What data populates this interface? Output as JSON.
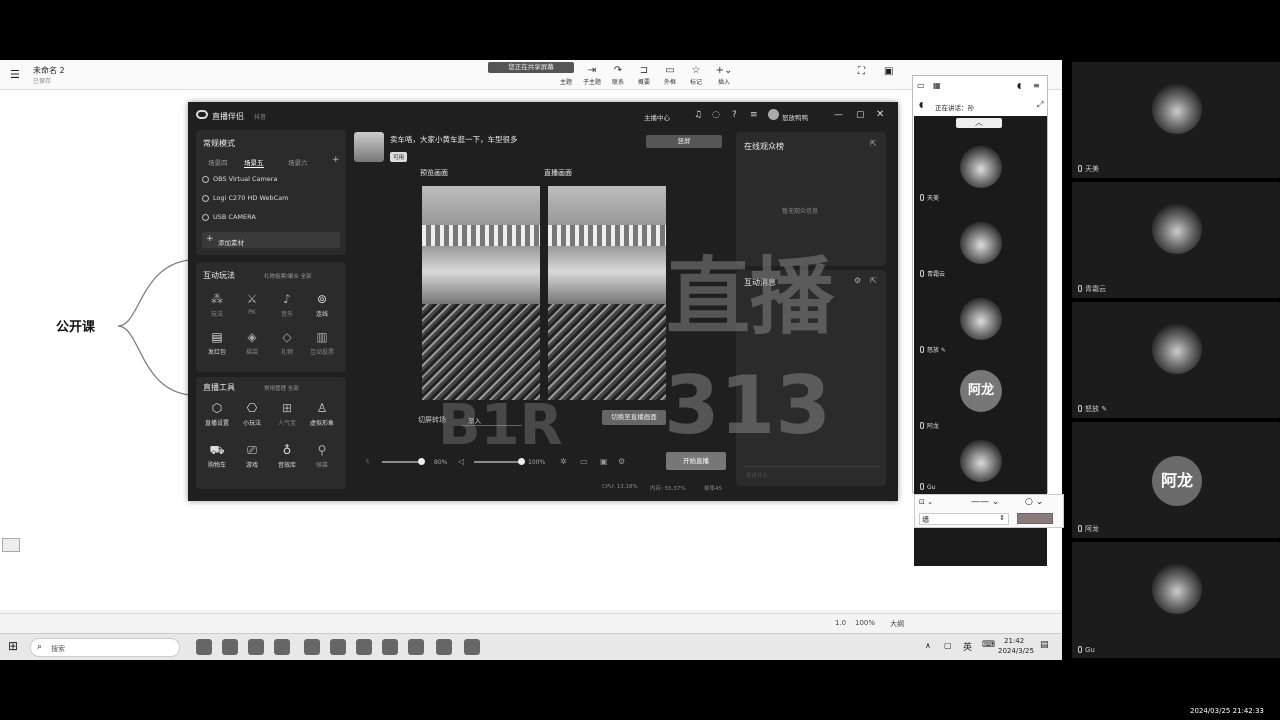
{
  "mindmap": {
    "title": "未命名 2",
    "subtitle": "已保存",
    "share_banner": "您正在共享屏幕",
    "toolbar": [
      {
        "label": "主题",
        "icon": "topic-icon"
      },
      {
        "label": "子主题",
        "icon": "subtopic-icon"
      },
      {
        "label": "联系",
        "icon": "relation-icon"
      },
      {
        "label": "概要",
        "icon": "summary-icon"
      },
      {
        "label": "外框",
        "icon": "boundary-icon"
      },
      {
        "label": "标记",
        "icon": "star-icon"
      },
      {
        "label": "插入",
        "icon": "plus-icon"
      }
    ],
    "right_tools": [
      "",
      ""
    ],
    "central_topic": "公开课",
    "status": {
      "zoom": "100%",
      "extra": "1.0",
      "mode": "大纲"
    }
  },
  "taskbar": {
    "search": "搜索",
    "time": "21:42",
    "date": "2024/3/25",
    "lang": "英"
  },
  "live_app": {
    "brand": "直播伴侣",
    "brand_sub": "抖音",
    "header_links": [
      "主播中心"
    ],
    "user": "怒放鸭鸭",
    "scene_panel": {
      "title": "常规模式",
      "tabs": [
        "场景四",
        "场景五",
        "场景六"
      ],
      "sources": [
        "OBS Virtual Camera",
        "Logi C270 HD WebCam",
        "USB CAMERA"
      ],
      "add_label": "添加素材"
    },
    "interact_panel": {
      "title": "互动玩法",
      "link": "礼物投票/聚合 全部",
      "items": [
        "玩法",
        "PK",
        "音乐",
        "连线",
        "发红包",
        "福袋",
        "礼物",
        "互动投票"
      ]
    },
    "tools_panel": {
      "title": "直播工具",
      "link": "常用管理 全部",
      "items": [
        "直播设置",
        "小玩法",
        "人气宝",
        "虚拟形象",
        "购物车",
        "游戏",
        "音效库",
        "弹幕"
      ]
    },
    "stream_title": "卖车咯，大家小黄车逛一下，车型很多",
    "stream_tag": "可用",
    "layout_button": "竖屏",
    "preview_label": "预览画面",
    "live_label": "直播画面",
    "transition_label": "切屏转场",
    "transition_value": "渐入",
    "switch_button": "切换至直播画面",
    "vol1": "80%",
    "vol2": "100%",
    "start_button": "开始直播",
    "stats": {
      "cpu": "CPU: 13.18%",
      "mem": "内存: 55.37%",
      "fps": "帧率45"
    },
    "audience_title": "在线观众榜",
    "audience_empty": "暂无观众信息",
    "interact_msg_title": "互动消息",
    "interact_msg_empty": "",
    "chat_placeholder": "说点什么"
  },
  "watermark": {
    "line1": "直播",
    "line2": "313",
    "code": "B1R"
  },
  "caption": "",
  "gallery": {
    "header": "正在讲话：孙",
    "participants": [
      {
        "name": "天美",
        "type": "photo"
      },
      {
        "name": "青霜云",
        "type": "photo"
      },
      {
        "name": "怒放",
        "type": "photo"
      },
      {
        "name": "阿龙",
        "type": "text",
        "text": "阿龙"
      },
      {
        "name": "Gu",
        "type": "photo"
      }
    ],
    "select_value": "墙"
  },
  "right_panel": {
    "tiles": [
      {
        "name": "天美",
        "type": "photo"
      },
      {
        "name": "青霜云",
        "type": "photo"
      },
      {
        "name": "怒放",
        "type": "photo"
      },
      {
        "name": "阿龙",
        "type": "text",
        "text": "阿龙"
      },
      {
        "name": "Gu",
        "type": "photo"
      }
    ]
  },
  "recording_timestamp": "2024/03/25 21:42:33"
}
